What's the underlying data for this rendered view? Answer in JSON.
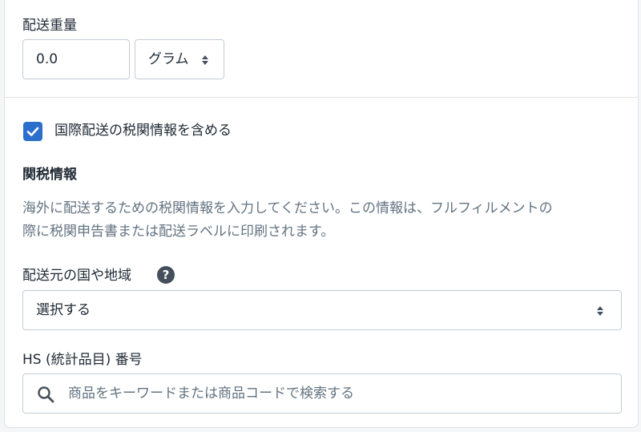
{
  "weight": {
    "label": "配送重量",
    "value": "0.0",
    "unit": "グラム"
  },
  "customs_checkbox": {
    "label": "国際配送の税関情報を含める",
    "checked": true
  },
  "customs": {
    "heading": "関税情報",
    "description_line1": "海外に配送するための税関情報を入力してください。この情報は、フルフィルメントの",
    "description_line2": "際に税関申告書または配送ラベルに印刷されます。"
  },
  "origin": {
    "label": "配送元の国や地域",
    "help": "?",
    "selected": "選択する"
  },
  "hs_code": {
    "label": "HS (統計品目) 番号",
    "placeholder": "商品をキーワードまたは商品コードで検索する"
  },
  "colors": {
    "accent": "#2c6ecb",
    "text": "#212b36",
    "subdued": "#637381",
    "border": "#c4cdd5"
  }
}
